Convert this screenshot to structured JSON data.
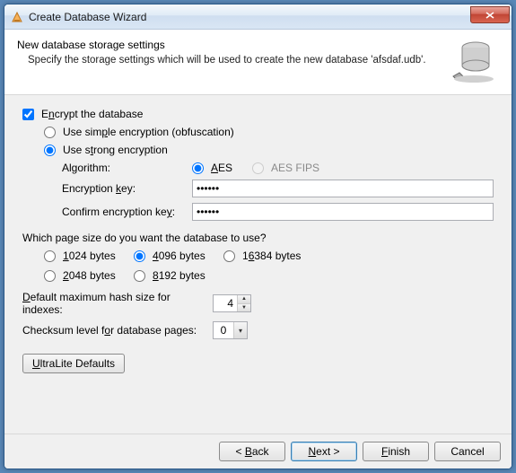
{
  "titlebar": {
    "title": "Create Database Wizard"
  },
  "header": {
    "title": "New database storage settings",
    "description": "Specify the storage settings which will be used to create the new database 'afsdaf.udb'."
  },
  "encrypt": {
    "checkbox_label_pre": "E",
    "checkbox_label_u": "n",
    "checkbox_label_post": "crypt the database",
    "checked": true,
    "simple_label_pre": "Use sim",
    "simple_label_u": "p",
    "simple_label_post": "le encryption (obfuscation)",
    "strong_label_pre": "Use s",
    "strong_label_u": "t",
    "strong_label_post": "rong encryption",
    "algorithm_label": "Algorithm:",
    "aes_u": "A",
    "aes_post": "ES",
    "aes_fips": "AES FIPS",
    "key_label_pre": "Encryption ",
    "key_label_u": "k",
    "key_label_post": "ey:",
    "confirm_label_pre": "Confirm encryption ke",
    "confirm_label_u": "y",
    "confirm_label_post": ":",
    "key_value": "••••••",
    "confirm_value": "••••••"
  },
  "page_size": {
    "question": "Which page size do you want the database to use?",
    "p1024_u": "1",
    "p1024_post": "024 bytes",
    "p4096_u": "4",
    "p4096_post": "096 bytes",
    "p16384_pre": "1",
    "p16384_u": "6",
    "p16384_post": "384 bytes",
    "p2048_u": "2",
    "p2048_post": "048 bytes",
    "p8192_u": "8",
    "p8192_post": "192 bytes"
  },
  "settings": {
    "hash_label_u": "D",
    "hash_label_post": "efault maximum hash size for indexes:",
    "hash_value": "4",
    "checksum_label_pre": "Checksum level f",
    "checksum_label_u": "o",
    "checksum_label_post": "r database pages:",
    "checksum_value": "0"
  },
  "defaults_btn_u": "U",
  "defaults_btn_post": "ltraLite Defaults",
  "footer": {
    "back_pre": "< ",
    "back_u": "B",
    "back_post": "ack",
    "next_u": "N",
    "next_post": "ext >",
    "finish_u": "F",
    "finish_post": "inish",
    "cancel": "Cancel"
  }
}
